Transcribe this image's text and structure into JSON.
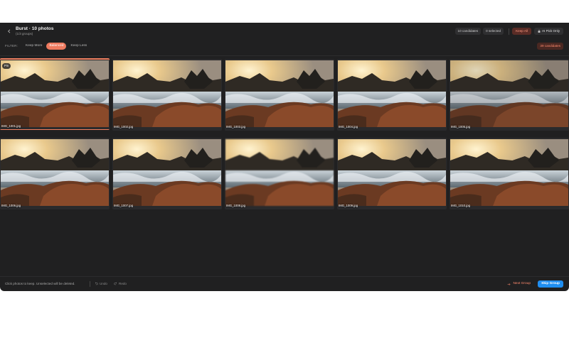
{
  "header": {
    "title": "Burst · 10 photos",
    "subtitle": "(1/3 groups)",
    "candidates_count": "10 candidates",
    "selected_count": "0 selected",
    "keep_all_label": "Keep All",
    "ai_pick_label": "AI Pick Only"
  },
  "filter": {
    "label": "FILTER:",
    "options": [
      "Keep More",
      "Balanced",
      "Keep Less"
    ],
    "active": "Balanced",
    "candidates_badge": "39 candidates"
  },
  "photos": [
    {
      "filename": "IMG_1001.jpg",
      "badge": "Pin",
      "selected": true
    },
    {
      "filename": "IMG_1002.jpg"
    },
    {
      "filename": "IMG_1003.jpg"
    },
    {
      "filename": "IMG_1004.jpg"
    },
    {
      "filename": "IMG_1005.jpg"
    },
    {
      "filename": "IMG_1006.jpg"
    },
    {
      "filename": "IMG_1007.jpg"
    },
    {
      "filename": "IMG_1008.jpg"
    },
    {
      "filename": "IMG_1009.jpg"
    },
    {
      "filename": "IMG_1010.jpg"
    }
  ],
  "footer": {
    "hint": "Click photos to keep. Unselected will be deleted.",
    "undo_label": "Undo",
    "redo_label": "Redo",
    "next_group_label": "Next Group",
    "skip_group_label": "Skip Group"
  },
  "colors": {
    "accent": "#ee7a5f",
    "primary_button": "#1f8ef1",
    "background": "#202021"
  },
  "icons": {
    "back": "chevron-left-icon",
    "ai_pick": "lock-icon",
    "undo": "undo-icon",
    "redo": "redo-icon",
    "next_group": "arrow-right-icon"
  }
}
